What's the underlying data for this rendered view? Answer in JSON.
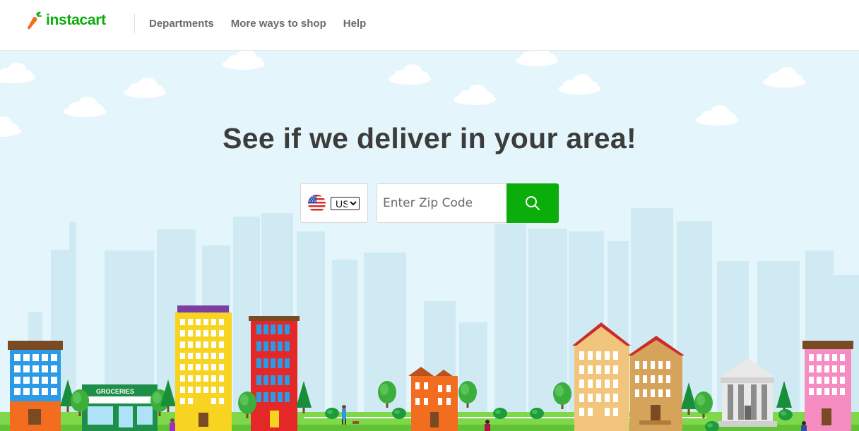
{
  "header": {
    "logo_text": "instacart",
    "nav": [
      {
        "label": "Departments"
      },
      {
        "label": "More ways to shop"
      },
      {
        "label": "Help"
      }
    ]
  },
  "hero": {
    "headline": "See if we deliver in your area!",
    "country_selected": "US",
    "zip_placeholder": "Enter Zip Code",
    "store_sign": "GROCERIES"
  },
  "colors": {
    "brand_green": "#0aad0a",
    "sky": "#e4f6fb",
    "carrot": "#f36d21"
  }
}
